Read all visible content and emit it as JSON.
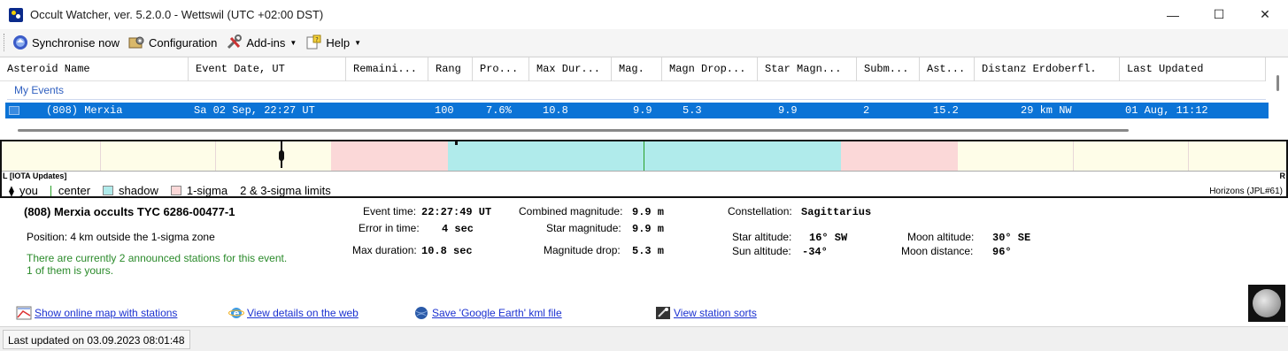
{
  "window": {
    "title": "Occult Watcher, ver. 5.2.0.0 - Wettswil (UTC +02:00 DST)",
    "minimize": "—",
    "maximize": "☐",
    "close": "✕"
  },
  "toolbar": {
    "synchronise": "Synchronise now",
    "configuration": "Configuration",
    "addins": "Add-ins",
    "help": "Help"
  },
  "grid": {
    "columns": [
      "Asteroid Name",
      "Event Date, UT",
      "Remaini...",
      "Rang",
      "Pro...",
      "Max Dur...",
      "Mag.",
      "Magn Drop...",
      "Star Magn...",
      "Subm...",
      "Ast...",
      "Distanz Erdoberfl.",
      "Last Updated"
    ],
    "group": "My Events",
    "row": {
      "asteroid": "(808) Merxia",
      "date": "Sa 02 Sep, 22:27 UT",
      "remaining": "",
      "rank": "100",
      "probability": "7.6%",
      "max_duration": "10.8",
      "mag": "9.9",
      "magn_drop": "5.3",
      "star_magn": "9.9",
      "submitted": "2",
      "ast": "15.2",
      "distance": "29 km NW",
      "last_updated": "01 Aug, 11:12"
    }
  },
  "track": {
    "left_label": "L [IOTA Updates]",
    "right_label": "R",
    "legend": {
      "you": "you",
      "center": "center",
      "shadow": "shadow",
      "one_sigma": "1-sigma",
      "limits": "2 & 3-sigma limits"
    },
    "horizons": "Horizons (JPL#61)",
    "colors": {
      "shadow": "#b0ebeb",
      "one_sigma": "#fbd8d8",
      "limits": "#fefde8",
      "center": "#2aa02a"
    }
  },
  "details": {
    "title": "(808) Merxia occults TYC 6286-00477-1",
    "position": "Position:  4 km outside the 1-sigma zone",
    "stations_line1": "There are currently 2 announced stations for this event.",
    "stations_line2": "1 of them is yours.",
    "event_time_label": "Event time:",
    "event_time": "22:27:49 UT",
    "error_label": "Error in time:",
    "error": "4 sec",
    "max_duration_label": "Max duration:",
    "max_duration": "10.8 sec",
    "combined_mag_label": "Combined magnitude:",
    "combined_mag": "9.9 m",
    "star_mag_label": "Star magnitude:",
    "star_mag": "9.9 m",
    "mag_drop_label": "Magnitude drop:",
    "mag_drop": "5.3 m",
    "constellation_label": "Constellation:",
    "constellation": "Sagittarius",
    "star_alt_label": "Star altitude:",
    "star_alt": "16° SW",
    "sun_alt_label": "Sun altitude:",
    "sun_alt": "-34°",
    "moon_alt_label": "Moon altitude:",
    "moon_alt": "30° SE",
    "moon_dist_label": "Moon distance:",
    "moon_dist": "96°",
    "links": {
      "map": "Show online map with stations",
      "web": "View details on the web",
      "kml": "Save 'Google Earth' kml file",
      "sorts": "View station sorts"
    }
  },
  "status": {
    "text": "Last updated on 03.09.2023 08:01:48"
  }
}
